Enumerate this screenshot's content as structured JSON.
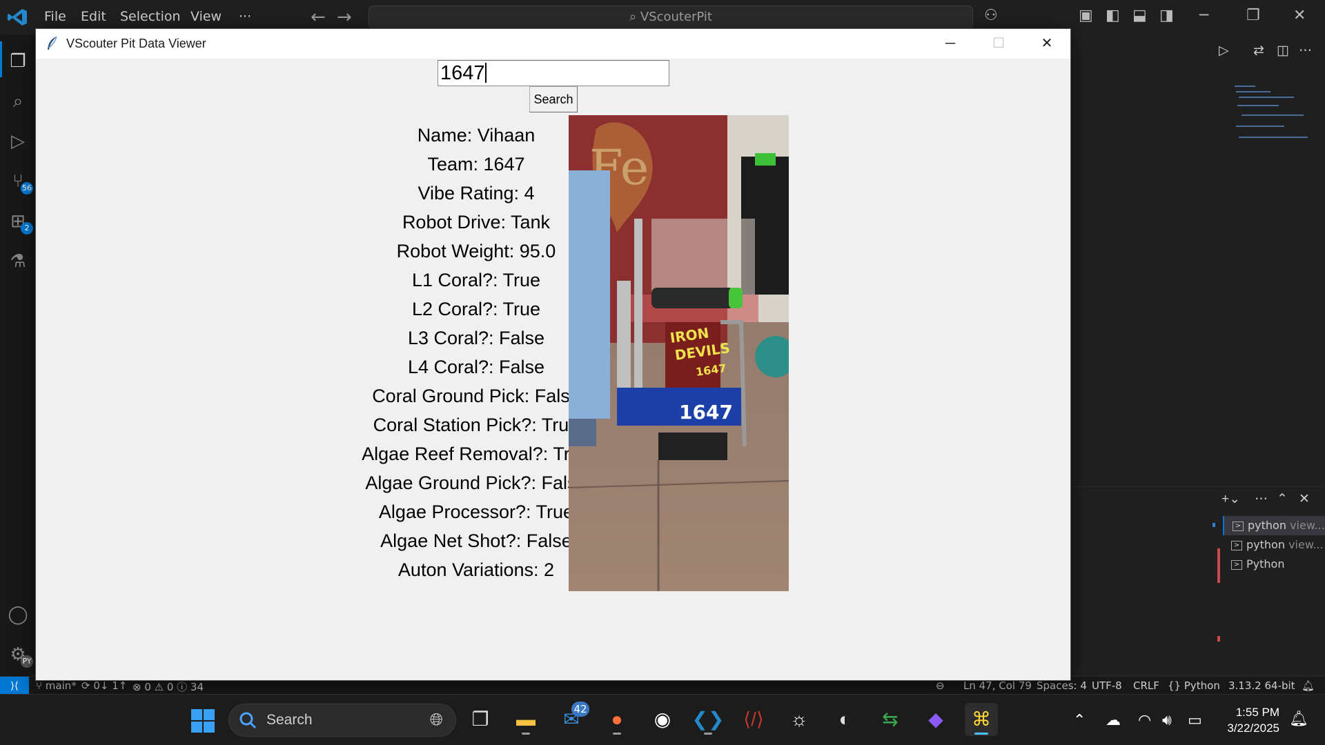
{
  "vscode": {
    "menu": [
      "File",
      "Edit",
      "Selection",
      "View",
      "···"
    ],
    "command_center": "VScouterPit",
    "activity_badges": {
      "source_control": "56",
      "extensions": "2",
      "settings": "PY"
    }
  },
  "terminal_list": [
    {
      "label": "python",
      "sub": "view..."
    },
    {
      "label": "python",
      "sub": "view..."
    },
    {
      "label": "Python",
      "sub": ""
    }
  ],
  "statusbar": {
    "branch": "main*",
    "sync": "0↓ 1↑",
    "problems": "⊗ 0 ⚠ 0 ⓘ 34",
    "cursor": "Ln 47, Col 79",
    "spaces": "Spaces: 4",
    "encoding": "UTF-8",
    "eol": "CRLF",
    "language": "{} Python",
    "interpreter": "3.13.2 64-bit"
  },
  "taskbar": {
    "search_label": "Search",
    "mail_badge": "42",
    "time": "1:55 PM",
    "date": "3/22/2025"
  },
  "tk_window": {
    "title": "VScouter Pit Data Viewer",
    "search_value": "1647",
    "search_button": "Search",
    "info_lines": [
      "Name: Vihaan",
      "Team: 1647",
      "Vibe Rating: 4",
      "Robot Drive: Tank",
      "Robot Weight: 95.0",
      "L1 Coral?: True",
      "L2 Coral?: True",
      "L3 Coral?: False",
      "L4 Coral?: False",
      "Coral Ground Pick: False",
      "Coral Station Pick?: True",
      "Algae Reef Removal?: True",
      "Algae Ground Pick?: False",
      "Algae Processor?: True",
      "Algae Net Shot?: False",
      "Auton Variations: 2"
    ],
    "photo_banner_text": "Fe",
    "photo_sign_lines": [
      "IRON",
      "DEVILS",
      "1647"
    ],
    "photo_bumper_number": "1647"
  },
  "colors": {
    "vscode_bg": "#1f1f1f",
    "accent": "#0078d4",
    "tk_bg": "#f0f0f0",
    "bumper_blue": "#1d3fa8",
    "banner_red": "#8b2f2f"
  }
}
